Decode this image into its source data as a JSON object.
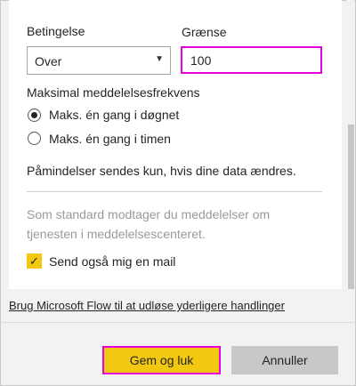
{
  "condition": {
    "label": "Betingelse",
    "value": "Over",
    "caret": "▼"
  },
  "limit": {
    "label": "Grænse",
    "value": "100"
  },
  "frequency": {
    "label": "Maksimal meddelelsesfrekvens",
    "options": [
      {
        "label": "Maks. én gang i døgnet",
        "selected": true
      },
      {
        "label": "Maks. én gang i timen",
        "selected": false
      }
    ]
  },
  "reminder_text": "Påmindelser sendes kun, hvis dine data ændres.",
  "notice": {
    "line1": "Som standard modtager du meddelelser om",
    "line2": "tjenesten i meddelelsescenteret."
  },
  "email_option": {
    "label": "Send også mig en mail",
    "checked": true,
    "check": "✓"
  },
  "flow_link": "Brug Microsoft Flow til at udløse yderligere handlinger",
  "buttons": {
    "save": "Gem og luk",
    "cancel": "Annuller"
  },
  "colors": {
    "accent": "#f2c811",
    "highlight": "#e600d9"
  }
}
